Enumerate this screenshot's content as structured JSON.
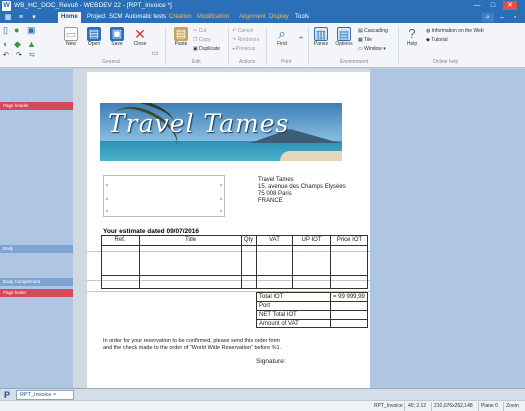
{
  "window": {
    "title": "WB_HC_DOC_Revu8 - WEBDEV 22 - [RPT_Invoice *]",
    "logo": "W",
    "controls": [
      "—",
      "□",
      "✕"
    ]
  },
  "ribbon_tabs": [
    "Home",
    "Project",
    "SCM",
    "Automatic tests",
    "Creation",
    "Modification",
    "Alignment",
    "Display",
    "Tools"
  ],
  "ribbon": {
    "buttons": {
      "new": "New",
      "open": "Open",
      "save": "Save",
      "close": "Close",
      "paste": "Paste",
      "find": "Find",
      "panes": "Panes",
      "options": "Options",
      "help": "Help"
    },
    "small": {
      "cut": "Cut",
      "copy": "Copy",
      "duplicate": "Duplicate",
      "cancel": "Cancel",
      "redo": "Re/do/ore",
      "previous": "Previous",
      "cascading": "Cascading",
      "tile": "Tile",
      "window": "Window",
      "info_web": "Information on the Web",
      "tutorial": "Tutorial"
    },
    "groups": [
      "General",
      "Edit",
      "Actions",
      "Print",
      "Environment",
      "Online help"
    ]
  },
  "bands": {
    "page_header": "Page header",
    "body": "Body",
    "body_complement": "Body Complement",
    "page_footer": "Page footer"
  },
  "report": {
    "logo_text": "Travel Tames",
    "address_lines": [
      "Travel Tames",
      "15, avenue des Champs Elysées",
      "75 008 Paris",
      "FRANCE"
    ],
    "estimate_title": "Your estimate dated 09/07/2016",
    "columns": [
      "Ref.",
      "Title",
      "Qty",
      "VAT",
      "UP IOT",
      "Price IOT"
    ],
    "totals": [
      {
        "label": "Total IOT",
        "value": "= 99 999,99"
      },
      {
        "label": "Port",
        "value": ""
      },
      {
        "label": "NET Total IOT",
        "value": ""
      },
      {
        "label": "Amount of VAT",
        "value": ""
      }
    ],
    "note_lines": [
      "In order for your reservation to be confirmed, please send this order form",
      "and the check made to the order of \"World Wide Reservation\" before %1."
    ],
    "signature": "Signature:"
  },
  "bottom": {
    "pane_letter": "P",
    "tab": "RPT_Invoice ×"
  },
  "status": {
    "name": "RPT_Invoice",
    "pos": "40; 2.12",
    "coords": "210,076x252,148",
    "plane": "Plane 0",
    "zoom": "Zoom"
  },
  "colors": {
    "accent": "#2a6fb8",
    "band_red": "#d44a5a",
    "band_blue": "#7ea4d4"
  }
}
